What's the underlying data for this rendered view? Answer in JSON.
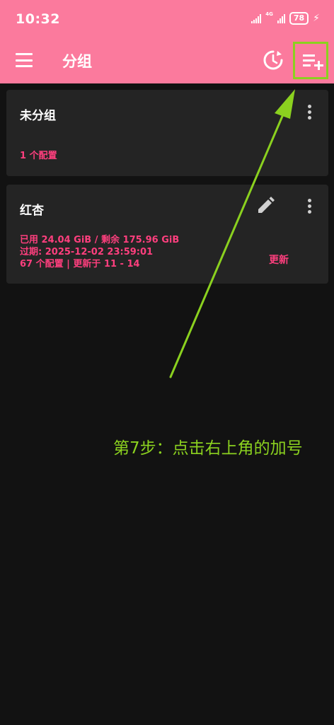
{
  "status_bar": {
    "time": "10:32",
    "network": "4G",
    "battery": "78"
  },
  "app_bar": {
    "title": "分组",
    "icons": [
      "menu-icon",
      "history-icon",
      "add-group-icon"
    ]
  },
  "groups": [
    {
      "name": "未分组",
      "config_count": "1 个配置"
    },
    {
      "name": "红杏",
      "usage": "已用 24.04 GiB / 剩余 175.96 GiB",
      "expiry": "过期: 2025-12-02 23:59:01",
      "summary": "67 个配置 | 更新于 11 - 14",
      "update_label": "更新"
    }
  ],
  "annotation": {
    "text": "第7步：点击右上角的加号",
    "color": "#8bd11f"
  },
  "colors": {
    "accent": "#fb7a9d",
    "pink_text": "#ff3f7e",
    "background": "#121212",
    "card": "#242424",
    "highlight": "#8bd11f"
  }
}
